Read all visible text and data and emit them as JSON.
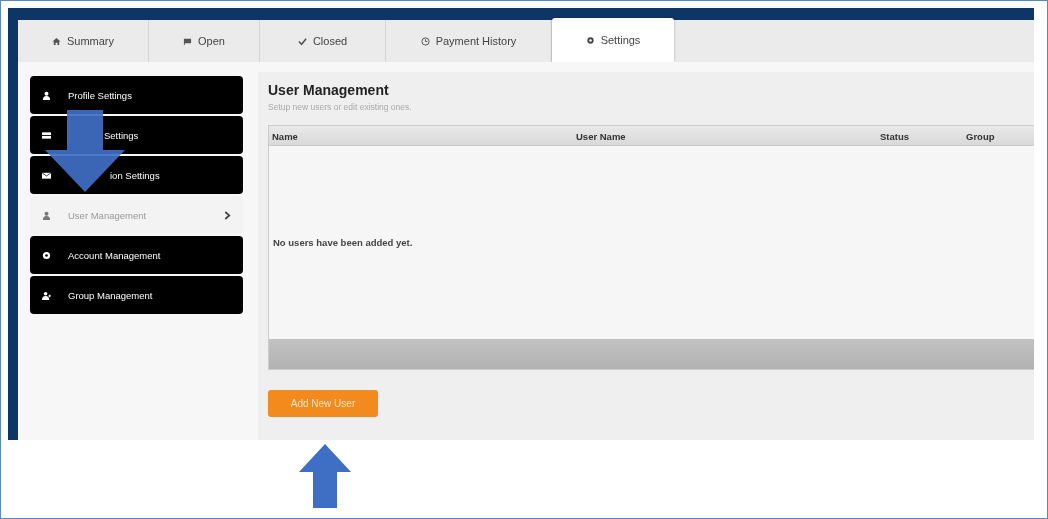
{
  "tabs": [
    {
      "label": "Summary",
      "selected": false
    },
    {
      "label": "Open",
      "selected": false
    },
    {
      "label": "Closed",
      "selected": false
    },
    {
      "label": "Payment History",
      "selected": false
    },
    {
      "label": "Settings",
      "selected": true
    }
  ],
  "sidebar": {
    "items": [
      {
        "label": "Profile Settings",
        "selected": false
      },
      {
        "label": "Settings",
        "selected": false
      },
      {
        "label": "ion Settings",
        "selected": false
      },
      {
        "label": "User Management",
        "selected": true
      },
      {
        "label": "Account Management",
        "selected": false
      },
      {
        "label": "Group Management",
        "selected": false
      }
    ]
  },
  "panel": {
    "title": "User Management",
    "subtitle": "Setup new users or edit existing ones.",
    "table": {
      "columns": [
        "Name",
        "User Name",
        "Status",
        "Group"
      ],
      "empty_message": "No users have been added yet."
    },
    "button": "Add New User"
  }
}
